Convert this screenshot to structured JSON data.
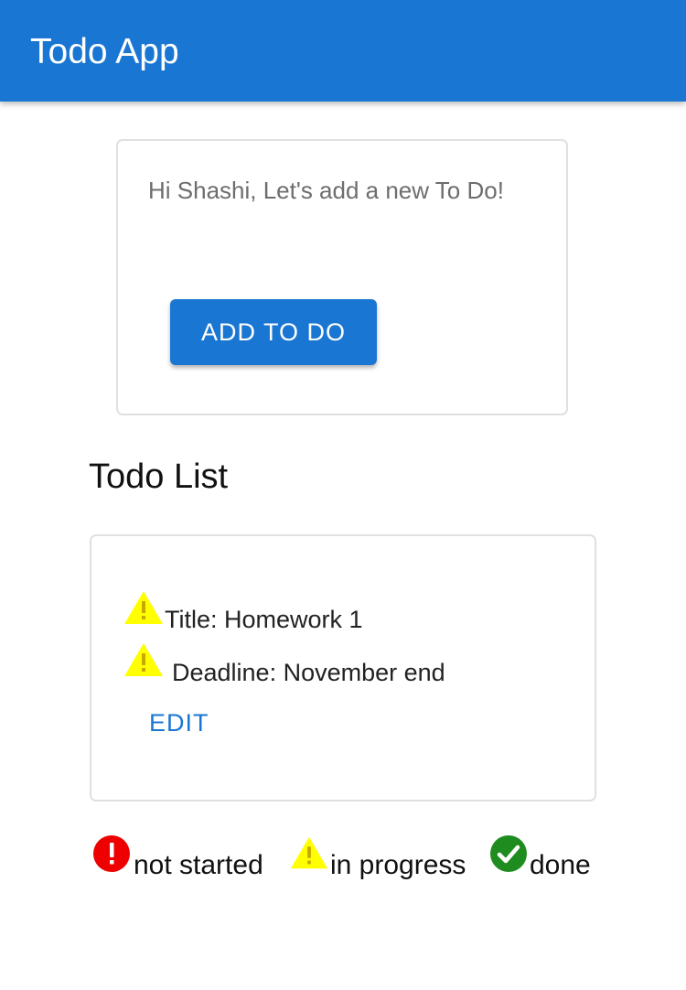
{
  "appbar": {
    "title": "Todo App",
    "color": "#1976d2"
  },
  "add_card": {
    "greeting": "Hi Shashi, Let's add a new To Do!",
    "add_button_label": "ADD TO DO"
  },
  "todo_list": {
    "heading": "Todo List",
    "items": [
      {
        "title_text": "Title: Homework 1",
        "deadline_text": "Deadline: November end",
        "status_icon": "warning-triangle-icon",
        "edit_label": "EDIT"
      }
    ]
  },
  "legend": {
    "items": [
      {
        "icon": "error-circle-icon",
        "label": "not started",
        "color": "#ee0000"
      },
      {
        "icon": "warning-triangle-icon",
        "label": "in progress",
        "color": "#ffff00"
      },
      {
        "icon": "check-circle-icon",
        "label": "done",
        "color": "#1e8c1e"
      }
    ]
  }
}
